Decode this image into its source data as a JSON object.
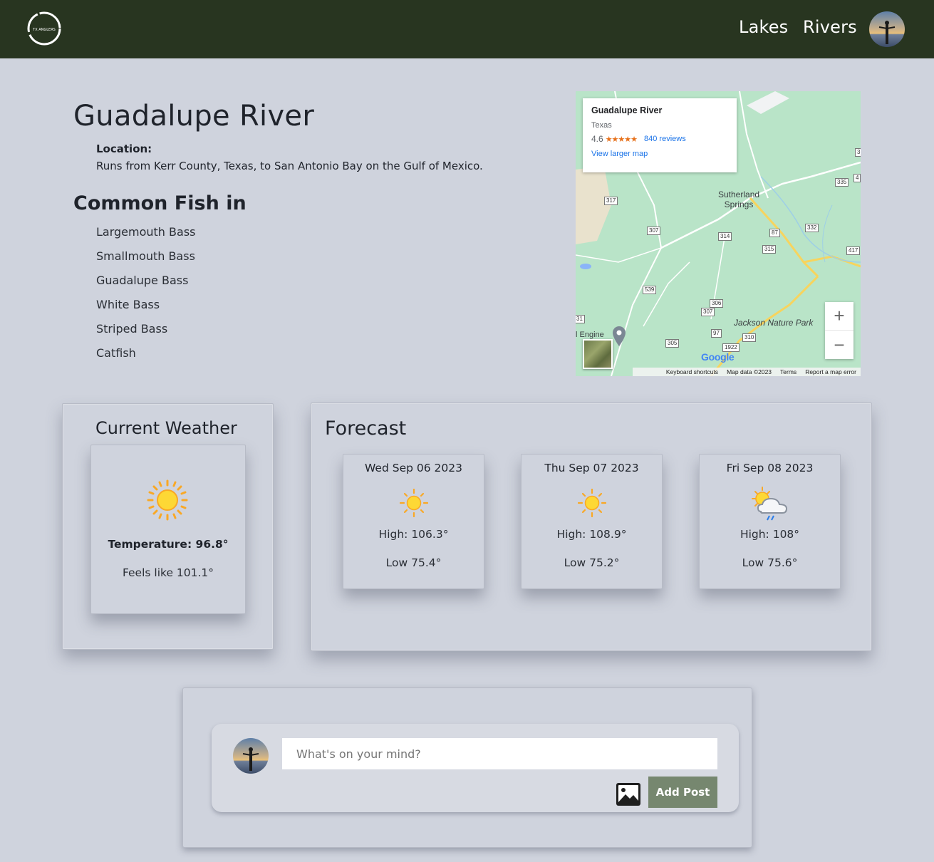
{
  "nav": {
    "logo_text": "TX ANGLERS",
    "links": [
      "Lakes",
      "Rivers"
    ]
  },
  "river": {
    "title": "Guadalupe River",
    "location_label": "Location:",
    "location_text": "Runs from Kerr County, Texas, to San Antonio Bay on the Gulf of Mexico.",
    "fish_heading": "Common Fish in",
    "fish": [
      "Largemouth Bass",
      "Smallmouth Bass",
      "Guadalupe Bass",
      "White Bass",
      "Striped Bass",
      "Catfish"
    ]
  },
  "map": {
    "place_name": "Guadalupe River",
    "place_region": "Texas",
    "rating": "4.6",
    "stars": "★★★★★",
    "reviews": "840 reviews",
    "view_larger": "View larger map",
    "zoom_in": "+",
    "zoom_out": "−",
    "town_line1": "Sutherland",
    "town_line2": "Springs",
    "park": "Jackson Nature Park",
    "engine": "l Engine",
    "google": "Google",
    "footer": {
      "shortcuts": "Keyboard shortcuts",
      "data": "Map data ©2023",
      "terms": "Terms",
      "report": "Report a map error"
    },
    "shields": [
      "317",
      "307",
      "314",
      "87",
      "315",
      "332",
      "335",
      "417",
      "539",
      "306",
      "307",
      "97",
      "310",
      "1922",
      "305",
      "31",
      "3",
      "4"
    ]
  },
  "current_weather": {
    "title": "Current Weather",
    "icon": "sun-icon",
    "temperature": "Temperature: 96.8°",
    "feels_like": "Feels like 101.1°"
  },
  "forecast": {
    "title": "Forecast",
    "days": [
      {
        "date": "Wed Sep 06 2023",
        "icon": "sun-icon",
        "high": "High: 106.3°",
        "low": "Low 75.4°"
      },
      {
        "date": "Thu Sep 07 2023",
        "icon": "sun-icon",
        "high": "High: 108.9°",
        "low": "Low 75.2°"
      },
      {
        "date": "Fri Sep 08 2023",
        "icon": "sun-cloud-rain-icon",
        "high": "High: 108°",
        "low": "Low 75.6°"
      }
    ]
  },
  "post": {
    "placeholder": "What's on your mind?",
    "add_label": "Add Post"
  },
  "colors": {
    "navbar": "#283520",
    "page_bg": "#cfd3dd",
    "button": "#76876f",
    "sun": "#fbbf17"
  }
}
